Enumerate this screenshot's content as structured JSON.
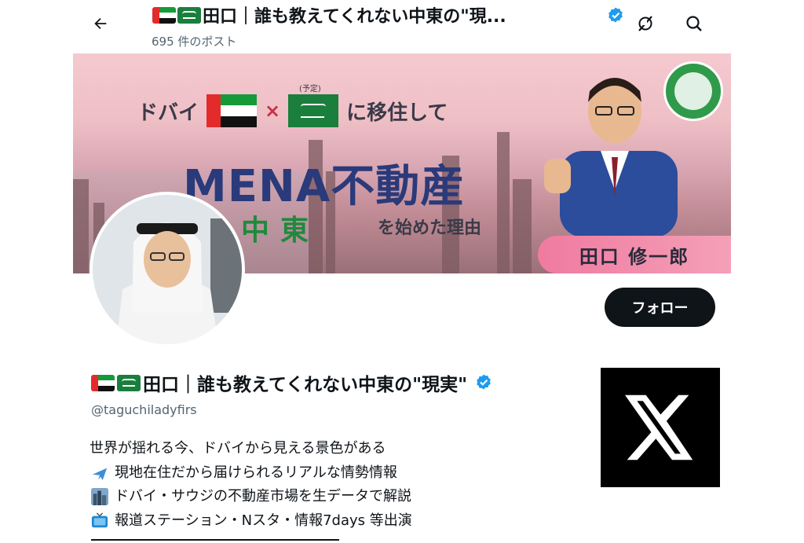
{
  "header": {
    "title": "田口｜誰も教えてくれない中東の\"現...",
    "posts_count": "695 件のポスト"
  },
  "banner": {
    "line1_left": "ドバイ",
    "line1_cross": "×",
    "line1_note": "(予定)",
    "line1_right": "に移住して",
    "mena": "MENA不動産",
    "chuto": "中東",
    "hajime": "を始めた理由",
    "person_name": "田口 修一郎"
  },
  "follow_button": {
    "label": "フォロー"
  },
  "profile": {
    "display_name": "田口｜誰も教えてくれない中東の\"現実\"",
    "handle": "@taguchiladyfirs",
    "bio": [
      {
        "icon": "",
        "text": "世界が揺れる今、ドバイから見える景色がある"
      },
      {
        "icon": "airplane-emoji",
        "text": "現地在住だから届けられるリアルな情勢情報"
      },
      {
        "icon": "cityscape-emoji",
        "text": "ドバイ・サウジの不動産市場を生データで解説"
      },
      {
        "icon": "tv-emoji",
        "text": "報道ステーション・Nスタ・情報7days 等出演"
      }
    ]
  },
  "colors": {
    "text_primary": "#0f1419",
    "text_secondary": "#536471",
    "verified_blue": "#1d9bf0",
    "follow_bg": "#0f1419",
    "follow_text": "#ffffff"
  }
}
